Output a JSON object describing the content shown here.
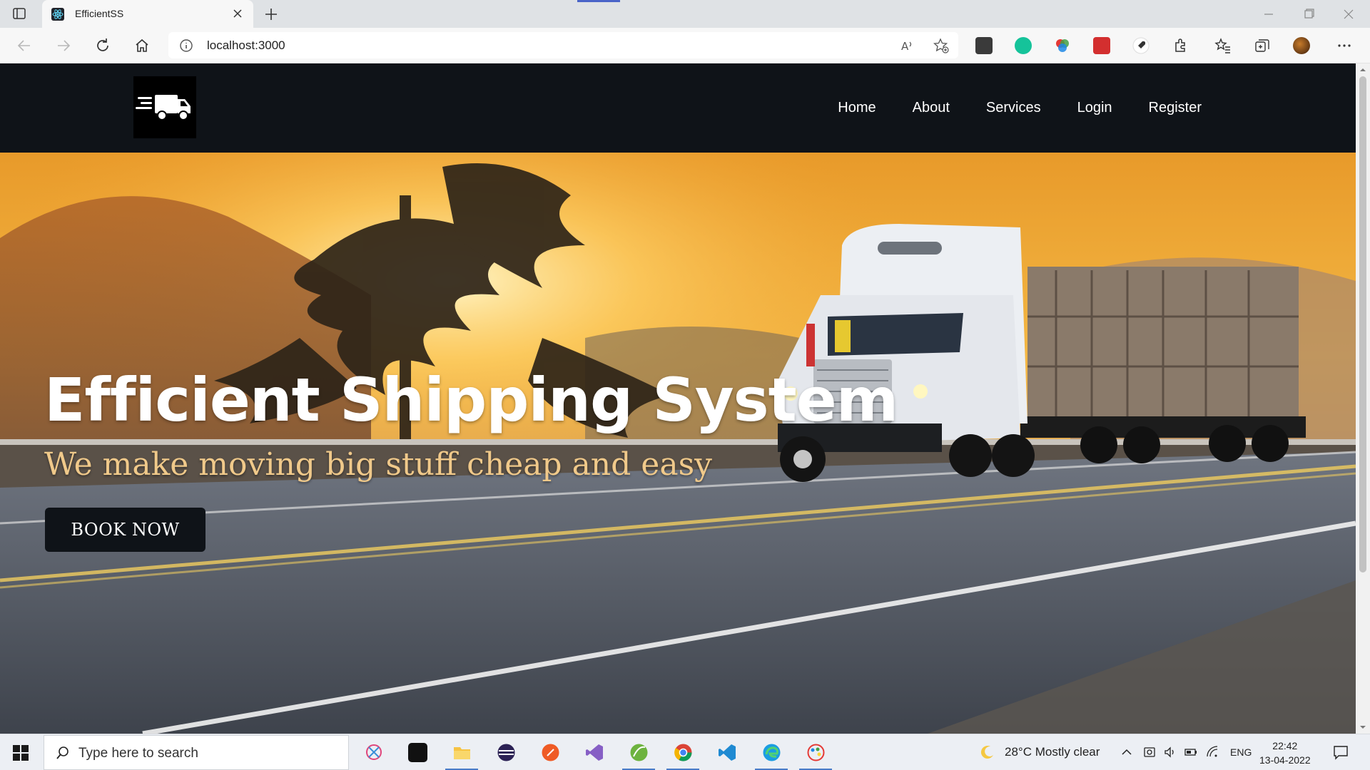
{
  "browser": {
    "tab_title": "EfficientSS",
    "url": "localhost:3000"
  },
  "site": {
    "nav": {
      "items": [
        "Home",
        "About",
        "Services",
        "Login",
        "Register"
      ]
    },
    "hero": {
      "title": "Efficient Shipping System",
      "subtitle": "We make moving big stuff cheap and easy",
      "cta_label": "BOOK NOW"
    }
  },
  "taskbar": {
    "search_placeholder": "Type here to search",
    "weather": "28°C  Mostly clear",
    "language": "ENG",
    "time": "22:42",
    "date": "13-04-2022"
  },
  "colors": {
    "navbar_bg": "#0f1318",
    "subtitle": "#f0c98a"
  }
}
